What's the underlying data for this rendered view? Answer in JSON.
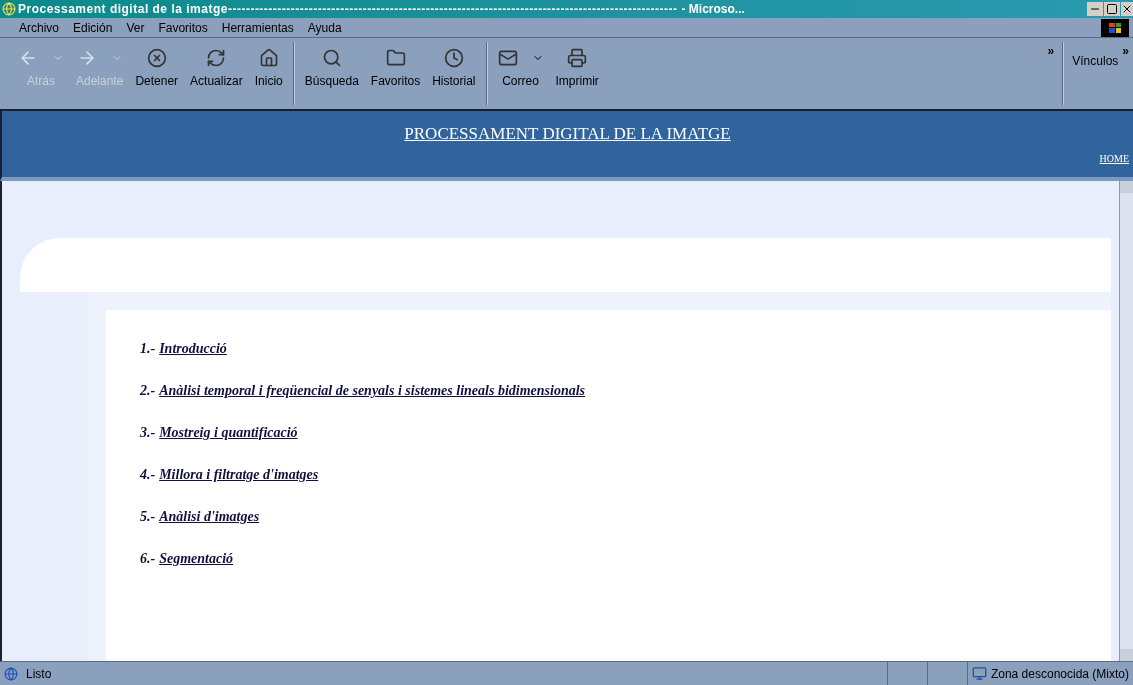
{
  "window": {
    "title": "Processament digital de la imatge----------------------------------------------------------------------------------------------------",
    "app": "- Microso..."
  },
  "menu": [
    "Archivo",
    "Edición",
    "Ver",
    "Favoritos",
    "Herramientas",
    "Ayuda"
  ],
  "toolbar": [
    {
      "kind": "button",
      "label": "Atrás",
      "disabled": true,
      "dropdown": true
    },
    {
      "kind": "button",
      "label": "Adelante",
      "disabled": true,
      "dropdown": true
    },
    {
      "kind": "button",
      "label": "Detener",
      "disabled": false,
      "dropdown": false
    },
    {
      "kind": "button",
      "label": "Actualizar",
      "disabled": false,
      "dropdown": false
    },
    {
      "kind": "button",
      "label": "Inicio",
      "disabled": false,
      "dropdown": false
    },
    {
      "kind": "separator"
    },
    {
      "kind": "button",
      "label": "Búsqueda",
      "disabled": false,
      "dropdown": false
    },
    {
      "kind": "button",
      "label": "Favoritos",
      "disabled": false,
      "dropdown": false
    },
    {
      "kind": "button",
      "label": "Historial",
      "disabled": false,
      "dropdown": false
    },
    {
      "kind": "separator"
    },
    {
      "kind": "button",
      "label": "Correo",
      "disabled": false,
      "dropdown": true
    },
    {
      "kind": "button",
      "label": "Imprimir",
      "disabled": false,
      "dropdown": false
    }
  ],
  "overflow": "»",
  "links_bar": {
    "label": "Vínculos",
    "overflow": "»"
  },
  "header": {
    "title": "PROCESSAMENT DIGITAL DE LA IMATGE",
    "home": "HOME"
  },
  "contents": [
    {
      "number": "1.-",
      "title": "Introducció"
    },
    {
      "number": "2.-",
      "title": "Anàlisi temporal i freqüencial de senyals i sistemes lineals bidimensionals"
    },
    {
      "number": "3.-",
      "title": "Mostreig i quantificació"
    },
    {
      "number": "4.-",
      "title": "Millora i filtratge d'imatges"
    },
    {
      "number": "5.-",
      "title": "Anàlisi d'imatges"
    },
    {
      "number": "6.-",
      "title": "Segmentació"
    }
  ],
  "status_bar": {
    "text": "Listo",
    "zone": "Zona desconocida (Mixto)"
  }
}
